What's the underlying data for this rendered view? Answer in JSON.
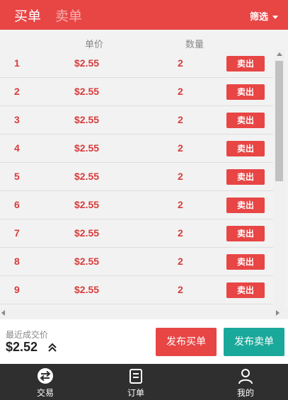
{
  "header": {
    "tab_buy": "买单",
    "tab_sell": "卖单",
    "filter_label": "筛选"
  },
  "columns": {
    "price": "单价",
    "quantity": "数量"
  },
  "orders": [
    {
      "index": "1",
      "price": "$2.55",
      "quantity": "2",
      "action": "卖出"
    },
    {
      "index": "2",
      "price": "$2.55",
      "quantity": "2",
      "action": "卖出"
    },
    {
      "index": "3",
      "price": "$2.55",
      "quantity": "2",
      "action": "卖出"
    },
    {
      "index": "4",
      "price": "$2.55",
      "quantity": "2",
      "action": "卖出"
    },
    {
      "index": "5",
      "price": "$2.55",
      "quantity": "2",
      "action": "卖出"
    },
    {
      "index": "6",
      "price": "$2.55",
      "quantity": "2",
      "action": "卖出"
    },
    {
      "index": "7",
      "price": "$2.55",
      "quantity": "2",
      "action": "卖出"
    },
    {
      "index": "8",
      "price": "$2.55",
      "quantity": "2",
      "action": "卖出"
    },
    {
      "index": "9",
      "price": "$2.55",
      "quantity": "2",
      "action": "卖出"
    }
  ],
  "summary": {
    "last_price_label": "最近成交价",
    "last_price": "$2.52",
    "publish_buy": "发布买单",
    "publish_sell": "发布卖单"
  },
  "nav": [
    {
      "label": "交易",
      "icon": "swap-icon"
    },
    {
      "label": "订单",
      "icon": "orders-icon"
    },
    {
      "label": "我的",
      "icon": "profile-icon"
    }
  ],
  "colors": {
    "accent": "#e84545",
    "teal": "#1aa89a",
    "nav_bg": "#2f2f2f"
  }
}
